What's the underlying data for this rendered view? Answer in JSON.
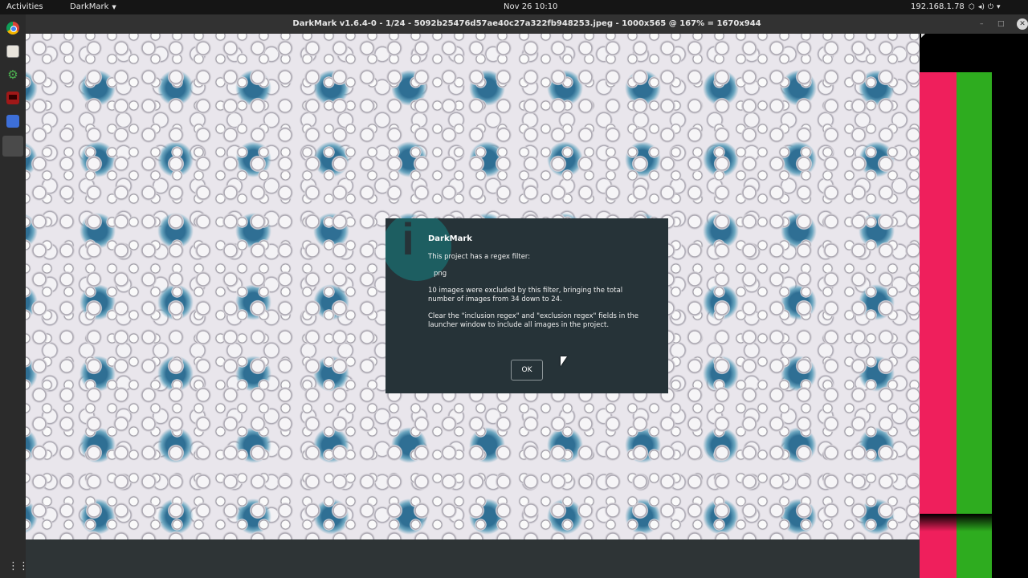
{
  "topbar": {
    "activities": "Activities",
    "app_menu": "DarkMark",
    "clock": "Nov 26  10:10",
    "ip": "192.168.1.78",
    "tray_icons": [
      "network-icon",
      "volume-icon",
      "power-icon",
      "chevron-down-icon"
    ]
  },
  "dock": {
    "items": [
      "chrome-icon",
      "files-icon",
      "settings-icon",
      "terminal-icon",
      "text-editor-icon",
      "darkmark-icon"
    ],
    "apps_grid": "show-applications-icon"
  },
  "window": {
    "title": "DarkMark v1.6.4-0 - 1/24 - 5092b25476d57ae40c27a322fb948253.jpeg - 1000x565 @ 167% = 1670x944",
    "min_glyph": "–",
    "max_glyph": "□",
    "close_glyph": "✕"
  },
  "dialog": {
    "title": "DarkMark",
    "icon_glyph": "i",
    "line1": "This project has a regex filter:",
    "regex": "png",
    "para2": "10 images were excluded by this filter, bringing the total number of images from 34 down to 24.",
    "para3": "Clear the \"inclusion regex\" and \"exclusion regex\" fields in the launcher window to include all images in the project.",
    "ok_label": "OK"
  },
  "colors": {
    "dialog_bg": "#263338",
    "info_circle": "#1d5e61",
    "strip_pink": "#ef1f5c",
    "strip_green": "#2eac1f"
  }
}
